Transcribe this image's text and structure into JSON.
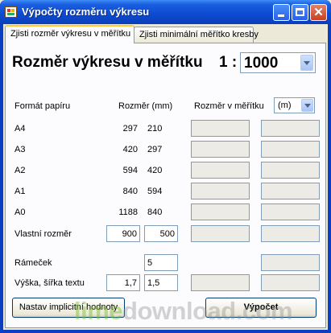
{
  "window": {
    "title": "Výpočty rozměru výkresu"
  },
  "tabs": [
    {
      "label": "Zjisti rozměr výkresu v měřítku",
      "active": true
    },
    {
      "label": "Zjisti minimální měřítko kresby",
      "active": false
    }
  ],
  "heading": {
    "text": "Rozměr výkresu v měřítku",
    "ratio_prefix": "1 :",
    "scale_value": "1000"
  },
  "columns": {
    "format": "Formát papíru",
    "size": "Rozměr (mm)",
    "scaled": "Rozměr v měřítku",
    "unit": "(m)"
  },
  "rows": [
    {
      "label": "A4",
      "w": "297",
      "h": "210"
    },
    {
      "label": "A3",
      "w": "420",
      "h": "297"
    },
    {
      "label": "A2",
      "w": "594",
      "h": "420"
    },
    {
      "label": "A1",
      "w": "840",
      "h": "594"
    },
    {
      "label": "A0",
      "w": "1188",
      "h": "840"
    }
  ],
  "custom": {
    "label": "Vlastní rozměr",
    "w": "900",
    "h": "500"
  },
  "frame": {
    "label": "Rámeček",
    "value": "5"
  },
  "text_size": {
    "label": "Výška, šířka textu",
    "v1": "1,7",
    "v2": "1,5"
  },
  "buttons": {
    "defaults": "Nastav implicitní hodnoty",
    "compute": "Výpočet"
  },
  "watermark": {
    "part1": "lime",
    "part2": "download",
    "part3": ".com"
  }
}
